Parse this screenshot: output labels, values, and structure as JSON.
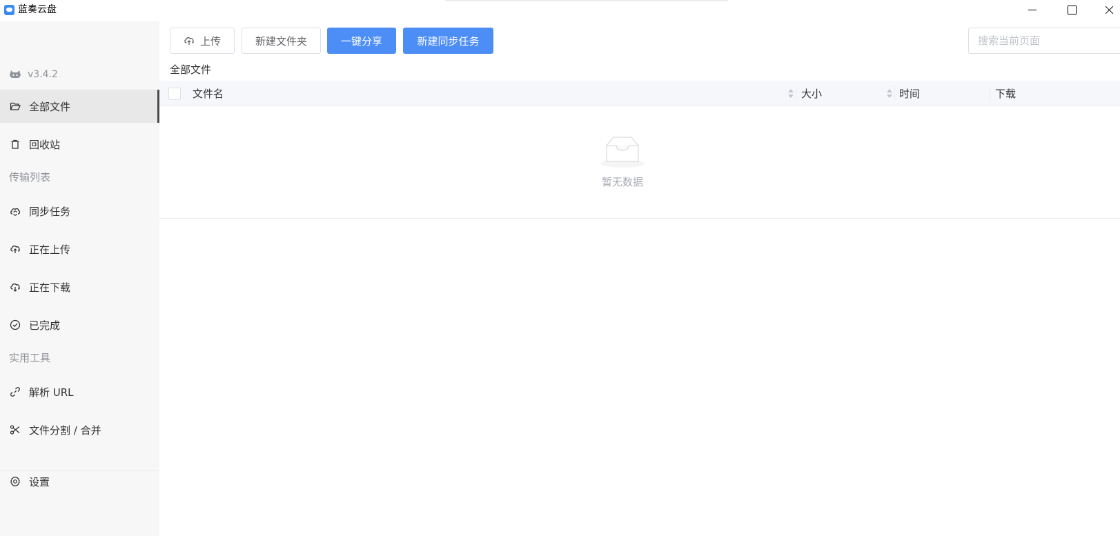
{
  "window": {
    "title": "蓝奏云盘"
  },
  "sidebar": {
    "version": "v3.4.2",
    "items": [
      {
        "label": "全部文件",
        "icon": "folder-open-icon",
        "active": true
      },
      {
        "label": "回收站",
        "icon": "trash-icon",
        "active": false
      }
    ],
    "transfer_section": "传输列表",
    "transfer_items": [
      {
        "label": "同步任务",
        "icon": "cloud-sync-icon"
      },
      {
        "label": "正在上传",
        "icon": "cloud-upload-icon"
      },
      {
        "label": "正在下载",
        "icon": "cloud-download-icon"
      },
      {
        "label": "已完成",
        "icon": "check-circle-icon"
      }
    ],
    "tools_section": "实用工具",
    "tool_items": [
      {
        "label": "解析 URL",
        "icon": "link-icon"
      },
      {
        "label": "文件分割 / 合并",
        "icon": "scissors-icon"
      }
    ],
    "settings": {
      "label": "设置",
      "icon": "gear-icon"
    }
  },
  "toolbar": {
    "upload_label": "上传",
    "new_folder_label": "新建文件夹",
    "share_label": "一键分享",
    "new_sync_label": "新建同步任务",
    "search_placeholder": "搜索当前页面"
  },
  "breadcrumb": "全部文件",
  "table": {
    "columns": [
      "文件名",
      "大小",
      "时间",
      "下载"
    ],
    "empty_text": "暂无数据"
  },
  "colors": {
    "primary": "#4c8df6",
    "sidebar_bg": "#f7f7f7",
    "active_bg": "#e8e8e8"
  }
}
